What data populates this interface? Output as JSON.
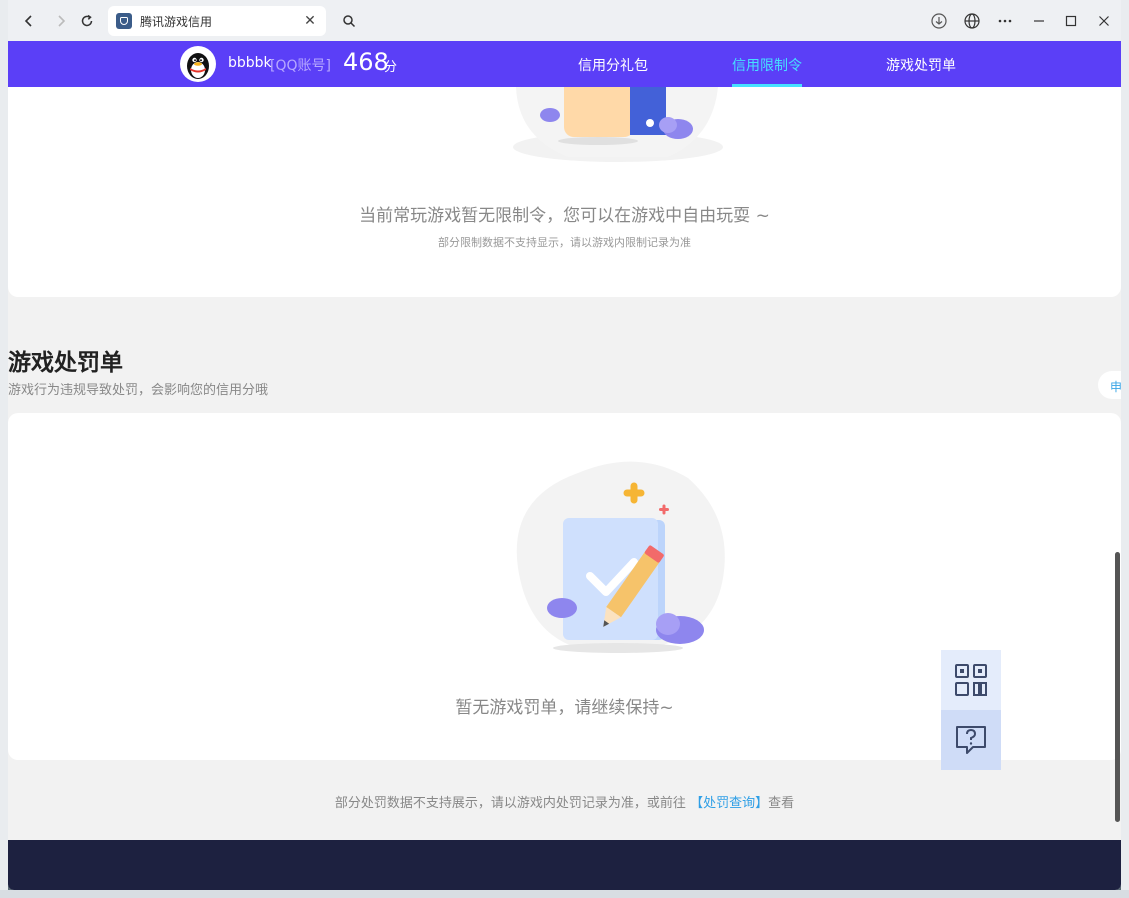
{
  "browser": {
    "tab_title": "腾讯游戏信用",
    "close_glyph": "✕"
  },
  "header": {
    "username": "bbbbk",
    "account_type": "[QQ账号]",
    "score": "468",
    "score_unit": "分",
    "nav": [
      {
        "label": "信用分礼包",
        "active": false
      },
      {
        "label": "信用限制令",
        "active": true
      },
      {
        "label": "游戏处罚单",
        "active": false
      }
    ],
    "brand_color": "#5b3ff7",
    "active_color": "#46e1ff"
  },
  "restriction": {
    "empty_message": "当前常玩游戏暂无限制令，您可以在游戏中自由玩耍 ~",
    "note": "部分限制数据不支持显示，请以游戏内限制记录为准"
  },
  "penalty": {
    "title": "游戏处罚单",
    "description": "游戏行为违规导致处罚，会影响您的信用分哦",
    "appeal_label": "申",
    "empty_message": "暂无游戏罚单，请继续保持~",
    "footer_prefix": "部分处罚数据不支持展示，请以游戏内处罚记录为准，或前往",
    "footer_link": "【处罚查询】",
    "footer_suffix": "查看"
  },
  "floating": {
    "qr_icon": "qr-code-icon",
    "help_icon": "help-chat-icon"
  }
}
